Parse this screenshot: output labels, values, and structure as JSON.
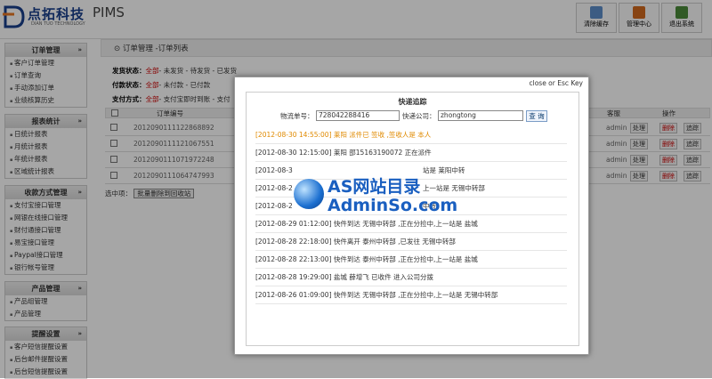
{
  "header": {
    "logo_cn": "点拓科技",
    "logo_pims": "PIMS",
    "logo_en": "DIAN TUO TECHNOLOGY",
    "buttons": [
      {
        "label": "清除缓存",
        "icon": "cache-icon",
        "color": "#5c8ec9"
      },
      {
        "label": "管理中心",
        "icon": "shield-icon",
        "color": "#d2691e"
      },
      {
        "label": "退出系统",
        "icon": "exit-icon",
        "color": "#4a8a3a"
      }
    ]
  },
  "sidebar": {
    "sections": [
      {
        "title": "订单管理",
        "items": [
          "客户订单管理",
          "订单查询",
          "手动添加订单",
          "业绩核算历史"
        ]
      },
      {
        "title": "报表统计",
        "items": [
          "日统计报表",
          "月统计报表",
          "年统计报表",
          "区域统计报表"
        ]
      },
      {
        "title": "收款方式管理",
        "items": [
          "支付宝接口管理",
          "网银在线接口管理",
          "财付通接口管理",
          "易宝接口管理",
          "Paypal接口管理",
          "银行帐号管理"
        ]
      },
      {
        "title": "产品管理",
        "items": [
          "产品组管理",
          "产品管理"
        ]
      },
      {
        "title": "提醒设置",
        "items": [
          "客户短信提醒设置",
          "后台邮件提醒设置",
          "后台短信提醒设置"
        ]
      }
    ]
  },
  "main": {
    "breadcrumb": "订单管理 -订单列表",
    "status": [
      {
        "label": "发货状态：",
        "all": "全部",
        "rest": "- 未发货 - 待发货 - 已发货"
      },
      {
        "label": "付款状态：",
        "all": "全部",
        "rest": "- 未付款 - 已付款"
      },
      {
        "label": "支付方式：",
        "all": "全部",
        "rest": "- 支付宝即时到账 - 支付"
      }
    ],
    "table": {
      "col_order": "订单编号",
      "col_customer": "客服",
      "col_actions": "操作",
      "rows": [
        {
          "order_id": "2012090111122868892",
          "customer": "admin"
        },
        {
          "order_id": "2012090111121067551",
          "customer": "admin"
        },
        {
          "order_id": "2012090111071972248",
          "customer": "admin"
        },
        {
          "order_id": "2012090111064747993",
          "customer": "admin"
        }
      ],
      "action_labels": [
        "处理",
        "删除",
        "追踪"
      ],
      "selected_label": "选中项：",
      "batch_delete": "批量删除到回收站"
    }
  },
  "modal": {
    "close_text": "close or Esc Key",
    "title": "快递追踪",
    "tracking_label": "物流单号：",
    "tracking_value": "728042288416",
    "company_label": "快递公司：",
    "company_value": "zhongtong",
    "query_button": "查 询",
    "records": [
      "[2012-08-30 14:55:00] 莱阳 派件已 签收 ,签收人是 本人",
      "[2012-08-30 12:15:00] 莱阳 邵15163190072 正在派件",
      "[2012-08-3",
      "[2012-08-2",
      "[2012-08-2",
      "[2012-08-29 01:12:00] 快件到达 无锡中转部 ,正在分捡中,上一站是 盐城",
      "[2012-08-28 22:18:00] 快件离开 泰州中转部 ,已发往 无锡中转部",
      "[2012-08-28 22:13:00] 快件到达 泰州中转部 ,正在分捡中,上一站是 盐城",
      "[2012-08-28 19:29:00] 盐城 薛增飞 已收件 进入公司分拨",
      "[2012-08-26 01:09:00] 快件到达 无锡中转部 ,正在分捡中,上一站是 无锡中转部"
    ],
    "partial_tails": [
      "站是 莱阳中转",
      "上一站是 无锡中转部",
      "中转"
    ]
  },
  "watermark": {
    "line1": "AS网站目录",
    "line2": "AdminSo.com"
  }
}
